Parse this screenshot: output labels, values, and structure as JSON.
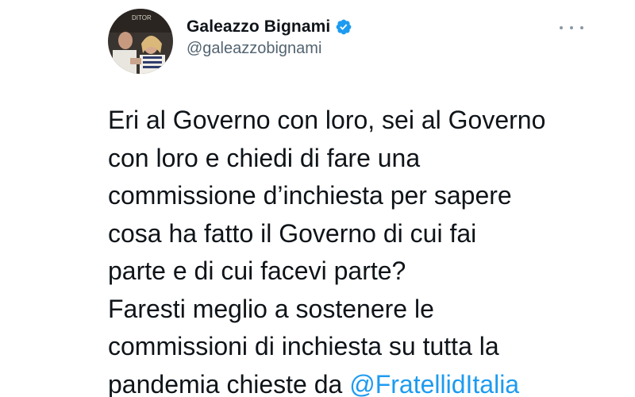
{
  "tweet": {
    "author": {
      "display_name": "Galeazzo Bignami",
      "handle": "@galeazzobignami",
      "verified": true,
      "verified_icon": "verified-badge-icon",
      "avatar_caption": "DITOR"
    },
    "more_icon": "more-options-icon",
    "text_lines": [
      "Eri al Governo con loro, sei al Governo",
      "con loro e chiedi di fare una",
      "commissione d’inchiesta per sapere",
      "cosa ha fatto il Governo di cui fai",
      "parte e di cui facevi parte?",
      "Faresti meglio a sostenere le",
      "commissioni di inchiesta su tutta la"
    ],
    "last_line_text": "pandemia chieste da ",
    "mention": "@FratellidItalia"
  },
  "colors": {
    "text": "#0f1419",
    "secondary": "#536471",
    "link": "#1d9bf0",
    "verified": "#1d9bf0"
  }
}
